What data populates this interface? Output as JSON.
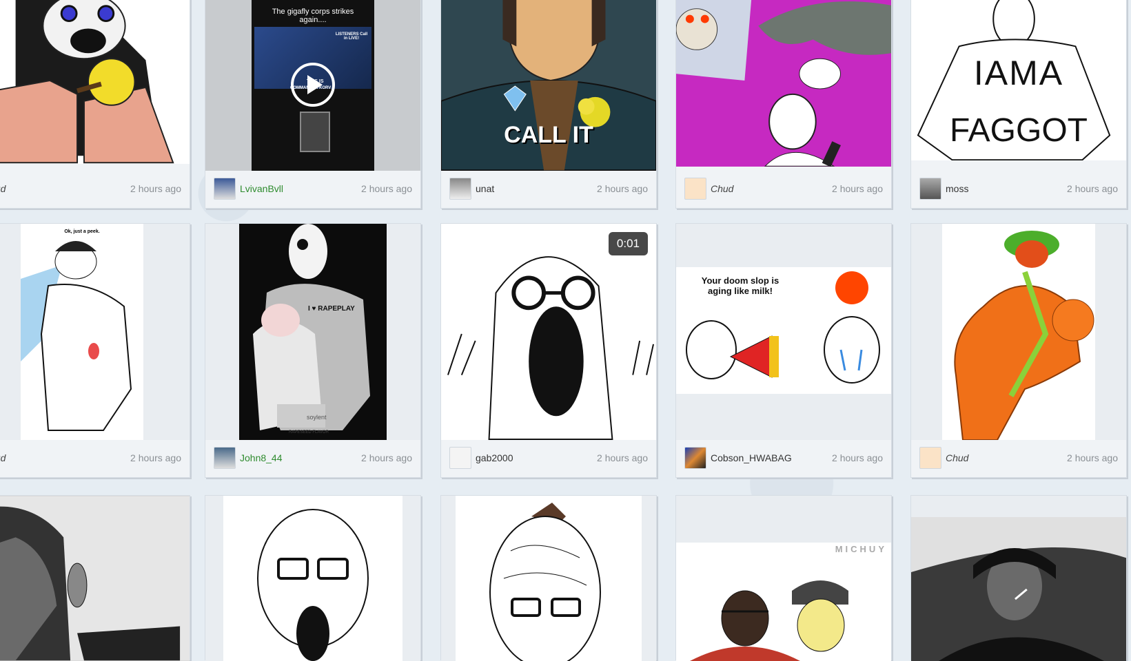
{
  "time_label": "2 hours ago",
  "cards": [
    {
      "user": "Chud",
      "style": "italic",
      "time": "2 hours ago"
    },
    {
      "user": "LvivanBvll",
      "style": "green",
      "time": "2 hours ago",
      "caption": "The gigafly corps strikes again....",
      "overlay1": "THIS IS",
      "overlay2": "COMMANDER KORV",
      "overlay3": "LISTENERS Call in LIVE!"
    },
    {
      "user": "unat",
      "style": "normal",
      "time": "2 hours ago",
      "caption": "CALL IT"
    },
    {
      "user": "Chud",
      "style": "italic",
      "time": "2 hours ago"
    },
    {
      "user": "moss",
      "style": "normal",
      "time": "2 hours ago",
      "caption1": "IAMA",
      "caption2": "FAGGOT"
    },
    {
      "user": "Chud",
      "style": "italic",
      "time": "2 hours ago",
      "caption": "Ok, just a peek."
    },
    {
      "user": "John8_44",
      "style": "green",
      "time": "2 hours ago",
      "caption1": "I ♥ RAPEPLAY",
      "caption2": "soylent",
      "caption3": "RAPESEED FLAVOR"
    },
    {
      "user": "gab2000",
      "style": "normal",
      "time": "2 hours ago",
      "badge": "0:01"
    },
    {
      "user": "Cobson_HWABAG",
      "style": "normal",
      "time": "2 hours ago",
      "caption": "Your doom slop is aging like milk!"
    },
    {
      "user": "Chud",
      "style": "italic",
      "time": "2 hours ago"
    },
    {
      "user": "",
      "style": "normal",
      "time": ""
    },
    {
      "user": "",
      "style": "normal",
      "time": ""
    },
    {
      "user": "",
      "style": "normal",
      "time": ""
    },
    {
      "user": "",
      "style": "normal",
      "time": "",
      "caption": "MICHUY"
    },
    {
      "user": "",
      "style": "normal",
      "time": ""
    }
  ],
  "colors": {
    "green_user": "#2e8b2e",
    "time": "#8a8f94",
    "card_bg": "#f0f3f6"
  }
}
